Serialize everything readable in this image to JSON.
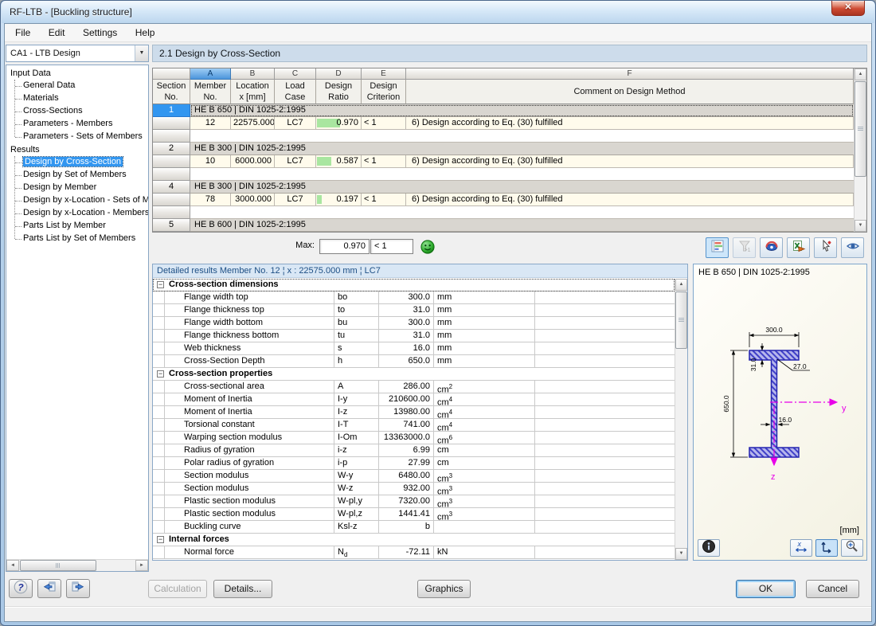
{
  "colors": {
    "selection_blue": "#3296f0",
    "ratio_bar_green": "#a9e6a0",
    "data_row_cream": "#fffbec",
    "section_row_gray": "#d9d6d0",
    "detail_header_blue": "#1c4e84",
    "titlebar_blue": "#bcd6ee",
    "close_red": "#cf4b33"
  },
  "icons": {
    "close": "✕",
    "dropdown": "▼",
    "scroll_up": "▲",
    "scroll_down": "▼",
    "scroll_left": "◄",
    "scroll_right": "►",
    "collapse": "−"
  },
  "window": {
    "title": "RF-LTB - [Buckling structure]"
  },
  "menu": {
    "items": [
      "File",
      "Edit",
      "Settings",
      "Help"
    ]
  },
  "case_selector": {
    "value": "CA1 - LTB Design"
  },
  "nav": {
    "sections": [
      {
        "label": "Input Data",
        "items": [
          {
            "label": "General Data"
          },
          {
            "label": "Materials"
          },
          {
            "label": "Cross-Sections"
          },
          {
            "label": "Parameters - Members"
          },
          {
            "label": "Parameters - Sets of Members"
          }
        ]
      },
      {
        "label": "Results",
        "items": [
          {
            "label": "Design by Cross-Section",
            "selected": true
          },
          {
            "label": "Design by Set of Members"
          },
          {
            "label": "Design by Member"
          },
          {
            "label": "Design by x-Location - Sets of M"
          },
          {
            "label": "Design by x-Location - Members"
          },
          {
            "label": "Parts List by Member"
          },
          {
            "label": "Parts List by Set of Members"
          }
        ]
      }
    ]
  },
  "panel": {
    "title": "2.1 Design by Cross-Section"
  },
  "table": {
    "active_col": "A",
    "col_letters": [
      "A",
      "B",
      "C",
      "D",
      "E",
      "F"
    ],
    "headers": [
      [
        "Section",
        "No."
      ],
      [
        "Member",
        "No."
      ],
      [
        "Location",
        "x [mm]"
      ],
      [
        "Load",
        "Case"
      ],
      [
        "Design",
        "Ratio"
      ],
      [
        "Design",
        "Criterion"
      ],
      [
        "Comment on Design Method"
      ]
    ],
    "rows": [
      {
        "type": "section",
        "no": "1",
        "text": "HE B 650 | DIN 1025-2:1995",
        "selected": true
      },
      {
        "type": "data",
        "member": "12",
        "location": "22575.000",
        "load_case": "LC7",
        "ratio": "0.970",
        "ratio_value": 0.97,
        "criterion": "< 1",
        "comment": "6) Design according to Eq. (30) fulfilled"
      },
      {
        "type": "spacer"
      },
      {
        "type": "section",
        "no": "2",
        "text": "HE B 300 | DIN 1025-2:1995"
      },
      {
        "type": "data",
        "member": "10",
        "location": "6000.000",
        "load_case": "LC7",
        "ratio": "0.587",
        "ratio_value": 0.587,
        "criterion": "< 1",
        "comment": "6) Design according to Eq. (30) fulfilled"
      },
      {
        "type": "spacer"
      },
      {
        "type": "section",
        "no": "4",
        "text": "HE B 300 | DIN 1025-2:1995"
      },
      {
        "type": "data",
        "member": "78",
        "location": "3000.000",
        "load_case": "LC7",
        "ratio": "0.197",
        "ratio_value": 0.197,
        "criterion": "< 1",
        "comment": "6) Design according to Eq. (30) fulfilled"
      },
      {
        "type": "spacer"
      },
      {
        "type": "section",
        "no": "5",
        "text": "HE B 600 | DIN 1025-2:1995"
      }
    ],
    "max": {
      "label": "Max:",
      "value": "0.970",
      "criterion": "< 1"
    }
  },
  "toolbar": {
    "buttons": [
      {
        "name": "result-diagrams",
        "active": true
      },
      {
        "name": "filter-ratios-greater-1",
        "disabled": true
      },
      {
        "name": "colored-relation-scales"
      },
      {
        "name": "excel-export"
      },
      {
        "name": "jump-to-graphic"
      },
      {
        "name": "view-mode"
      }
    ]
  },
  "details": {
    "header": "Detailed results Member No. 12  ¦  x : 22575.000 mm  ¦  LC7",
    "rows": [
      {
        "type": "group",
        "label": "Cross-section dimensions",
        "selected": true
      },
      {
        "type": "row",
        "label": "Flange width top",
        "sym": "bo",
        "value": "300.0",
        "unit": "mm"
      },
      {
        "type": "row",
        "label": "Flange thickness top",
        "sym": "to",
        "value": "31.0",
        "unit": "mm"
      },
      {
        "type": "row",
        "label": "Flange width bottom",
        "sym": "bu",
        "value": "300.0",
        "unit": "mm"
      },
      {
        "type": "row",
        "label": "Flange thickness bottom",
        "sym": "tu",
        "value": "31.0",
        "unit": "mm"
      },
      {
        "type": "row",
        "label": "Web thickness",
        "sym": "s",
        "value": "16.0",
        "unit": "mm"
      },
      {
        "type": "row",
        "label": "Cross-Section Depth",
        "sym": "h",
        "value": "650.0",
        "unit": "mm"
      },
      {
        "type": "group",
        "label": "Cross-section properties"
      },
      {
        "type": "row",
        "label": "Cross-sectional area",
        "sym": "A",
        "value": "286.00",
        "unit": "cm",
        "exp": "2"
      },
      {
        "type": "row",
        "label": "Moment of Inertia",
        "sym": "I-y",
        "value": "210600.00",
        "unit": "cm",
        "exp": "4"
      },
      {
        "type": "row",
        "label": "Moment of Inertia",
        "sym": "I-z",
        "value": "13980.00",
        "unit": "cm",
        "exp": "4"
      },
      {
        "type": "row",
        "label": "Torsional constant",
        "sym": "I-T",
        "value": "741.00",
        "unit": "cm",
        "exp": "4"
      },
      {
        "type": "row",
        "label": "Warping section modulus",
        "sym": "I-Om",
        "value": "13363000.0",
        "unit": "cm",
        "exp": "6"
      },
      {
        "type": "row",
        "label": "Radius of gyration",
        "sym": "i-z",
        "value": "6.99",
        "unit": "cm"
      },
      {
        "type": "row",
        "label": "Polar radius of gyration",
        "sym": "i-p",
        "value": "27.99",
        "unit": "cm"
      },
      {
        "type": "row",
        "label": "Section modulus",
        "sym": "W-y",
        "value": "6480.00",
        "unit": "cm",
        "exp": "3"
      },
      {
        "type": "row",
        "label": "Section modulus",
        "sym": "W-z",
        "value": "932.00",
        "unit": "cm",
        "exp": "3"
      },
      {
        "type": "row",
        "label": "Plastic section modulus",
        "sym": "W-pl,y",
        "value": "7320.00",
        "unit": "cm",
        "exp": "3"
      },
      {
        "type": "row",
        "label": "Plastic section modulus",
        "sym": "W-pl,z",
        "value": "1441.41",
        "unit": "cm",
        "exp": "3"
      },
      {
        "type": "row",
        "label": "Buckling curve",
        "sym": "Ksl-z",
        "value": "b",
        "unit": ""
      },
      {
        "type": "group",
        "label": "Internal forces"
      },
      {
        "type": "row",
        "label": "Normal force",
        "sym": "N",
        "symsub": "d",
        "value": "-72.11",
        "unit": "kN"
      }
    ]
  },
  "section_panel": {
    "title": "HE B 650 | DIN 1025-2:1995",
    "dims": {
      "width": "300.0",
      "flange_thickness": "31.0",
      "fillet_radius": "27.0",
      "height": "650.0",
      "web_thickness": "16.0"
    },
    "axes": {
      "y": "y",
      "z": "z"
    },
    "units_label": "[mm]",
    "buttons": [
      {
        "name": "info"
      },
      {
        "name": "x-dimensions"
      },
      {
        "name": "coordinate-system",
        "active": true
      },
      {
        "name": "zoom-cross-section"
      }
    ]
  },
  "footer": {
    "nav_buttons": [
      {
        "name": "help"
      },
      {
        "name": "previous-table"
      },
      {
        "name": "next-table"
      }
    ],
    "calculation": "Calculation",
    "details": "Details...",
    "graphics": "Graphics",
    "ok": "OK",
    "cancel": "Cancel"
  }
}
